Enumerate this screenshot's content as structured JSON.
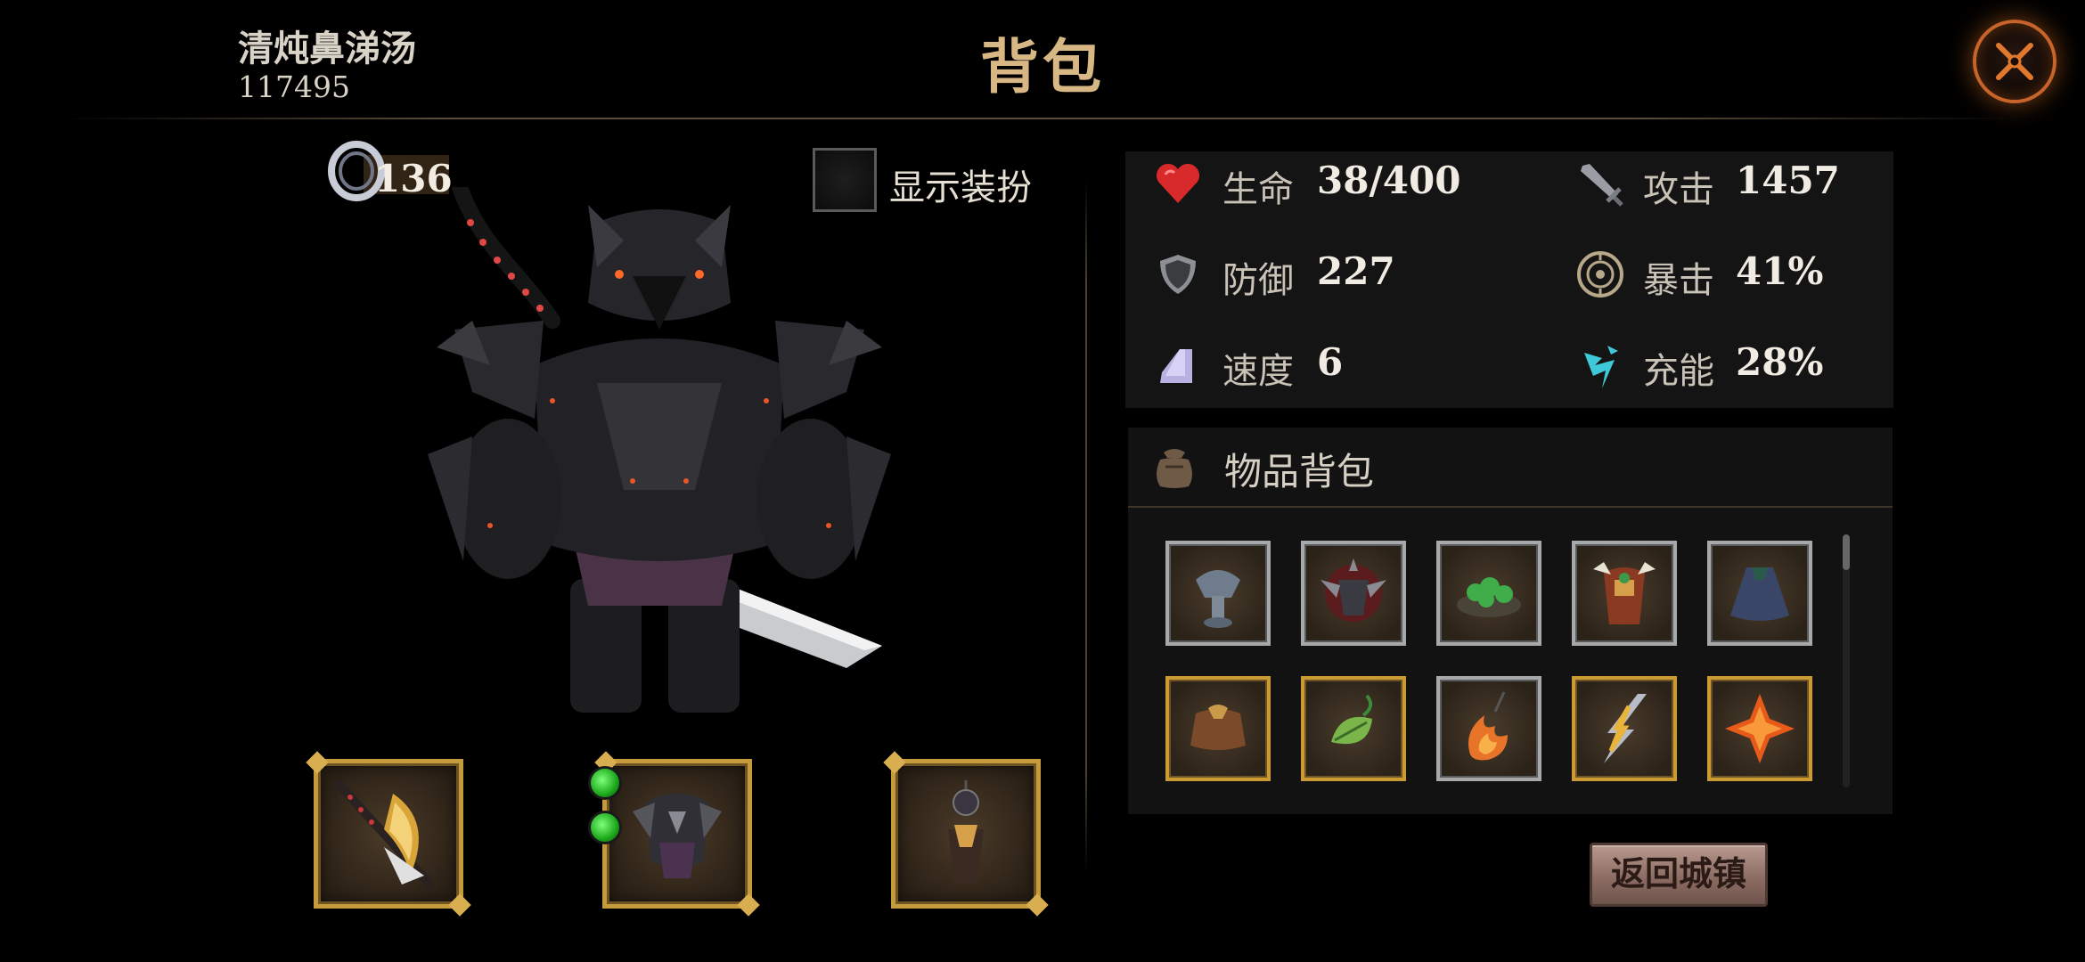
{
  "header": {
    "player_name": "清炖鼻涕汤",
    "player_id": "117495",
    "title": "背包"
  },
  "character": {
    "level": "136",
    "show_costume_label": "显示装扮",
    "show_costume_checked": false
  },
  "stats": [
    {
      "label": "生命",
      "value": "38/400",
      "icon": "heart-icon"
    },
    {
      "label": "攻击",
      "value": "1457",
      "icon": "sword-icon"
    },
    {
      "label": "防御",
      "value": "227",
      "icon": "shield-icon"
    },
    {
      "label": "暴击",
      "value": "41%",
      "icon": "crit-icon"
    },
    {
      "label": "速度",
      "value": "6",
      "icon": "boot-icon"
    },
    {
      "label": "充能",
      "value": "28%",
      "icon": "energy-icon"
    }
  ],
  "inventory": {
    "title": "物品背包",
    "items": [
      {
        "name": "iron-helmet",
        "rarity": "silver"
      },
      {
        "name": "spiked-shoulder",
        "rarity": "silver"
      },
      {
        "name": "green-gem-plate",
        "rarity": "silver"
      },
      {
        "name": "tribal-armor",
        "rarity": "silver"
      },
      {
        "name": "dark-cloak",
        "rarity": "silver"
      },
      {
        "name": "brown-cloak",
        "rarity": "gold"
      },
      {
        "name": "leaf-amulet",
        "rarity": "gold"
      },
      {
        "name": "flame-necklace",
        "rarity": "silver"
      },
      {
        "name": "lightning-blade",
        "rarity": "gold"
      },
      {
        "name": "fire-shuriken",
        "rarity": "gold"
      }
    ]
  },
  "equipment": [
    {
      "slot": "weapon",
      "name": "scythe-blade",
      "gems": 0
    },
    {
      "slot": "armor",
      "name": "dark-armor",
      "gems": 2
    },
    {
      "slot": "accessory",
      "name": "dark-amulet",
      "gems": 0
    }
  ],
  "return_button": "返回城镇",
  "colors": {
    "title_gold": "#d7b783",
    "close_orange": "#c8642a",
    "panel_bg": "#141414",
    "gold_frame": "#c59a3a",
    "silver_frame": "#a6a8aa"
  }
}
